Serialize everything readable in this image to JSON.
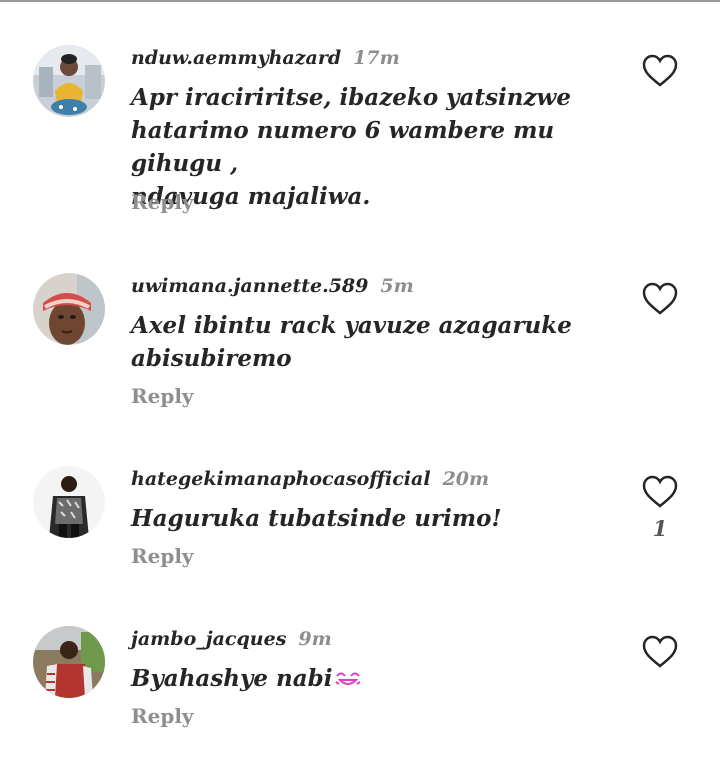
{
  "comments": [
    {
      "username": "nduw.aemmyhazard",
      "time": "17m",
      "text_lines": [
        "Apr iraciriritse, ibazeko yatsinzwe",
        "hatarimo numero 6 wambere mu gihugu ,",
        "ndavuga majaliwa."
      ],
      "reply_label": "Reply",
      "like_icon": "heart-outline-icon",
      "like_count": ""
    },
    {
      "username": "uwimana.jannette.589",
      "time": "5m",
      "text_lines": [
        "Axel ibintu rack yavuze azagaruke",
        "abisubiremo"
      ],
      "reply_label": "Reply",
      "like_icon": "heart-outline-icon",
      "like_count": ""
    },
    {
      "username": "hategekimanaphocasofficial",
      "time": "20m",
      "text_lines": [
        "Haguruka tubatsinde urimo!"
      ],
      "reply_label": "Reply",
      "like_icon": "heart-outline-icon",
      "like_count": "1"
    },
    {
      "username": "jambo_jacques",
      "time": "9m",
      "text_lines": [
        "Byahashye nabi"
      ],
      "emoji": "laughing-face-emoji",
      "reply_label": "Reply",
      "like_icon": "heart-outline-icon",
      "like_count": ""
    }
  ],
  "colors": {
    "text": "#262626",
    "secondary": "#8e8e8e",
    "emoji": "#e040c8"
  }
}
